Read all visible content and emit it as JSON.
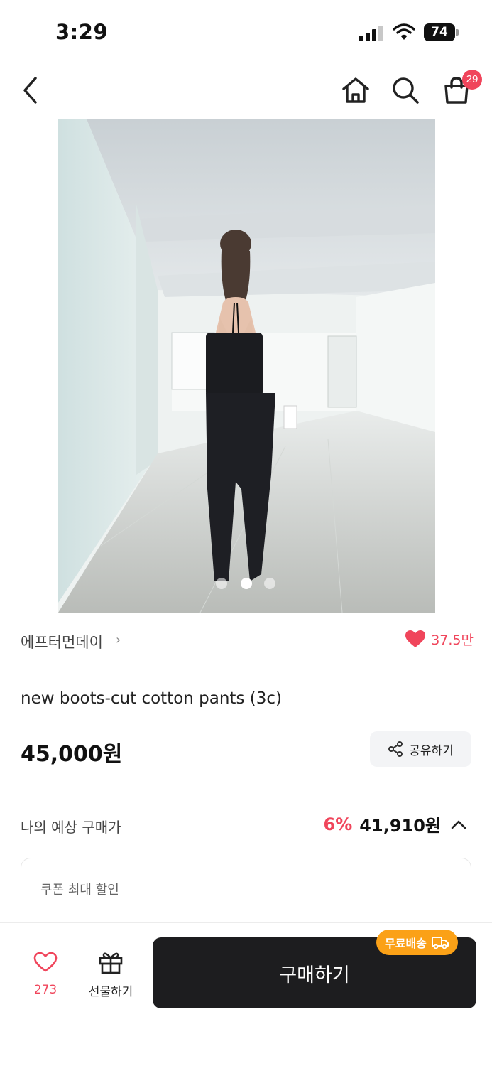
{
  "status_bar": {
    "time": "3:29",
    "battery": "74"
  },
  "nav": {
    "cart_count": "29"
  },
  "carousel": {
    "total": 3,
    "active_index": 1
  },
  "brand": {
    "name": "에프터먼데이",
    "chevron": "›",
    "likes": "37.5만"
  },
  "product": {
    "title": "new boots-cut cotton pants (3c)",
    "price": "45,000원",
    "share_label": "공유하기"
  },
  "estimate": {
    "label": "나의 예상 구매가",
    "discount": "6%",
    "price": "41,910원"
  },
  "coupon": {
    "title": "쿠폰 최대 할인"
  },
  "bottom": {
    "wish_count": "273",
    "gift_label": "선물하기",
    "buy_label": "구매하기",
    "free_shipping": "무료배송"
  },
  "colors": {
    "accent_red": "#f0455b",
    "buy_button": "#1d1d1f",
    "free_ship_badge": "#fba117"
  },
  "icons": [
    "back-icon",
    "home-icon",
    "search-icon",
    "cart-icon",
    "heart-icon",
    "share-icon",
    "chevron-up-icon",
    "gift-icon",
    "truck-icon"
  ]
}
